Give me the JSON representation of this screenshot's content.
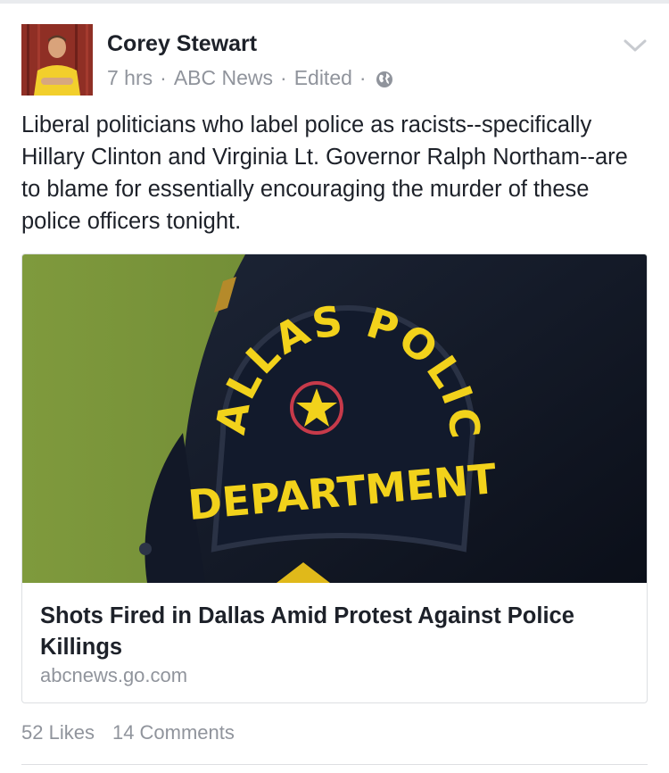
{
  "post": {
    "author": "Corey Stewart",
    "time": "7 hrs",
    "via": "ABC News",
    "edited": "Edited",
    "separator": "·",
    "privacy_icon": "globe-icon",
    "menu_icon": "chevron-down-icon",
    "text": "Liberal politicians who label police as racists--specifically Hillary Clinton and Virginia Lt. Governor Ralph Northam--are to blame for essentially encouraging the murder of these police officers tonight."
  },
  "link_card": {
    "title": "Shots Fired in Dallas Amid Protest Against Police Killings",
    "domain": "abcnews.go.com",
    "patch": {
      "top_text": "DALLAS POLICE",
      "bottom_text": "DEPARTMENT"
    }
  },
  "stats": {
    "likes": "52 Likes",
    "comments": "14 Comments"
  },
  "colors": {
    "text_primary": "#1d2129",
    "text_secondary": "#90949c",
    "border": "#dddfe2",
    "patch_yellow": "#f2d21b",
    "uniform_navy": "#151b2a"
  }
}
